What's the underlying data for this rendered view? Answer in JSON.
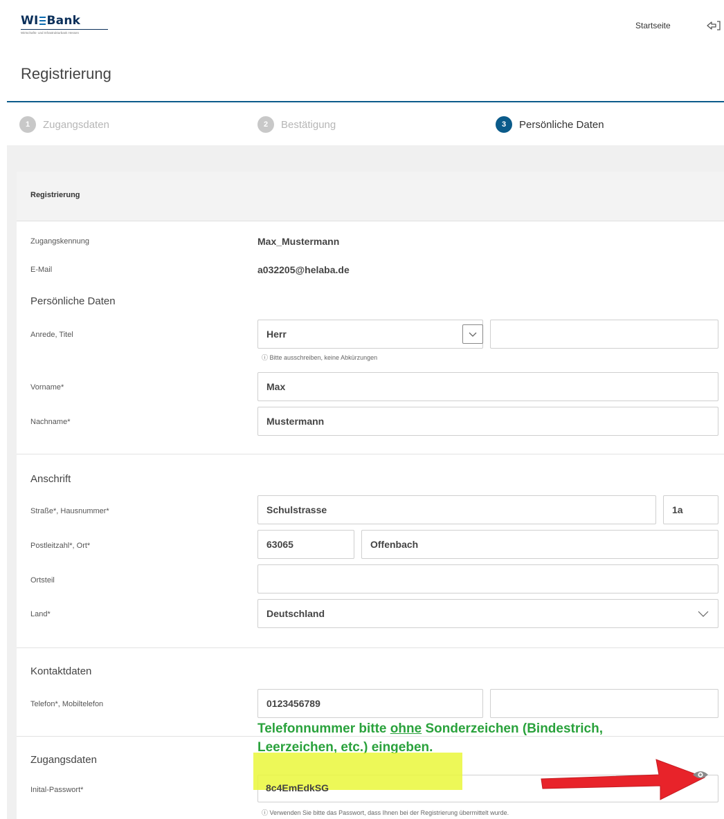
{
  "header": {
    "logo_wi": "WI",
    "logo_bank": "Bank",
    "logo_sub": "Wirtschafts- und Infrastrukturbank Hessen",
    "startseite": "Startseite",
    "logout_icon": "logout-icon"
  },
  "page_title": "Registrierung",
  "steps": [
    {
      "num": "1",
      "label": "Zugangsdaten",
      "state": "inactive"
    },
    {
      "num": "2",
      "label": "Bestätigung",
      "state": "inactive"
    },
    {
      "num": "3",
      "label": "Persönliche Daten",
      "state": "active"
    }
  ],
  "card_header": "Registrierung",
  "account": {
    "kennung_label": "Zugangskennung",
    "kennung_value": "Max_Mustermann",
    "email_label": "E-Mail",
    "email_value": "a032205@helaba.de"
  },
  "personal": {
    "heading": "Persönliche Daten",
    "anrede_label": "Anrede, Titel",
    "anrede_value": "Herr",
    "titel_value": "",
    "anrede_hint": "ⓘ  Bitte ausschreiben, keine Abkürzungen",
    "vorname_label": "Vorname*",
    "vorname_value": "Max",
    "nachname_label": "Nachname*",
    "nachname_value": "Mustermann"
  },
  "address": {
    "heading": "Anschrift",
    "strasse_label": "Straße*, Hausnummer*",
    "strasse_value": "Schulstrasse",
    "hausnummer_value": "1a",
    "plz_label": "Postleitzahl*, Ort*",
    "plz_value": "63065",
    "ort_value": "Offenbach",
    "ortsteil_label": "Ortsteil",
    "ortsteil_value": "",
    "land_label": "Land*",
    "land_value": "Deutschland"
  },
  "contact": {
    "heading": "Kontaktdaten",
    "telefon_label": "Telefon*, Mobiltelefon",
    "telefon_value": "0123456789",
    "mobil_value": ""
  },
  "annotation": {
    "line1_pre": "Telefonnummer bitte ",
    "line1_underline": "ohne",
    "line1_post": " Sonderzeichen (Bindestrich,",
    "line2": "Leerzeichen, etc.) eingeben."
  },
  "access": {
    "heading": "Zugangsdaten",
    "password_label": "Inital-Passwort*",
    "password_value": "8c4EmEdkSG",
    "password_hint": "ⓘ  Verwenden Sie bitte das Passwort, dass Ihnen bei der Registrierung übermittelt wurde."
  },
  "colors": {
    "accent": "#0b5b8a",
    "note_green": "#2aa23c",
    "highlight_yellow": "#eaf73b",
    "arrow_red": "#e8232a"
  }
}
